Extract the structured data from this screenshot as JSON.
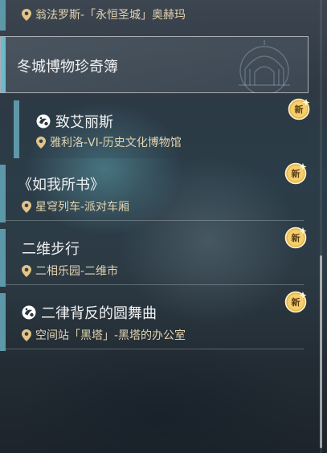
{
  "top_item": {
    "location": "翁法罗斯-「永恒圣城」奥赫玛"
  },
  "section": {
    "title": "冬城博物珍奇簿"
  },
  "items": [
    {
      "title": "致艾丽斯",
      "has_quest_icon": true,
      "location": "雅利洛-VI-历史文化博物馆",
      "badge": "新"
    },
    {
      "title": "《如我所书》",
      "has_quest_icon": false,
      "location": "星穹列车-派对车厢",
      "badge": "新"
    },
    {
      "title": "二维步行",
      "has_quest_icon": false,
      "location": "二相乐园-二维市",
      "badge": "新"
    },
    {
      "title": "二律背反的圆舞曲",
      "has_quest_icon": true,
      "location": "空间站「黑塔」-黑塔的办公室",
      "badge": "新"
    }
  ],
  "colors": {
    "accent": "#5d98a9",
    "location_text": "#e3d3b0",
    "badge_gold": "#e8b64a"
  }
}
